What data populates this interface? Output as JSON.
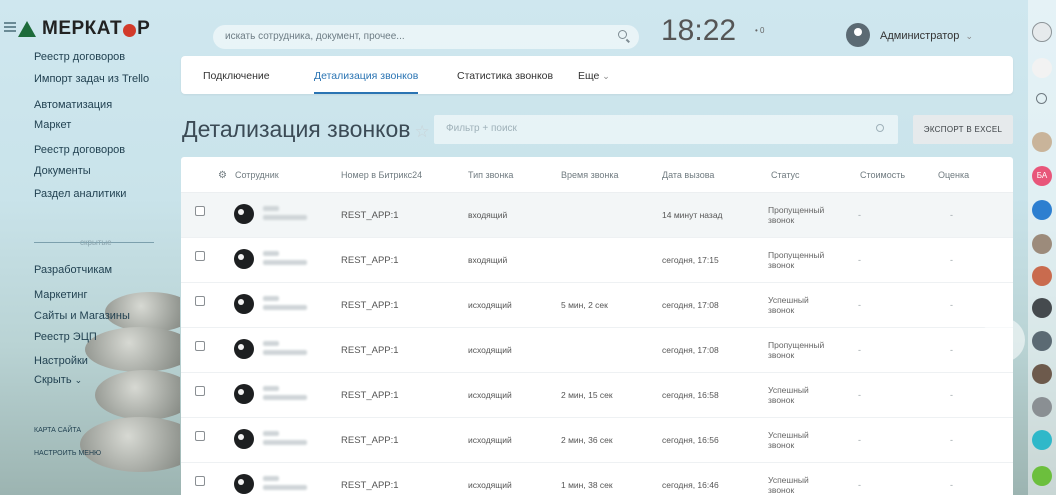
{
  "header": {
    "brand": "МЕРКАТ",
    "brand_suffix": "Р",
    "search_placeholder": "искать сотрудника, документ, прочее...",
    "time": "18:22",
    "notif": "• 0",
    "user_name": "Администратор",
    "user_chevron": "⌄"
  },
  "sidebar": {
    "items_top": [
      "Реестр договоров",
      "Импорт задач из Trello",
      "Автоматизация",
      "Маркет",
      "Реестр договоров",
      "Документы",
      "Раздел аналитики"
    ],
    "separator_label": "скрытые",
    "items_bottom": [
      "Разработчикам",
      "Маркетинг",
      "Сайты и Магазины",
      "Реестр ЭЦП",
      "Настройки",
      "Скрыть"
    ],
    "hide_suffix": "⌄",
    "links": [
      "КАРТА САЙТА",
      "НАСТРОИТЬ МЕНЮ"
    ]
  },
  "tabs": {
    "items": [
      "Подключение",
      "Детализация звонков",
      "Статистика звонков",
      "Еще"
    ],
    "more_chevron": "⌄"
  },
  "page": {
    "title": "Детализация звонков",
    "star": "☆",
    "filter_placeholder": "Фильтр + поиск",
    "export_label": "ЭКСПОРТ В EXCEL"
  },
  "table": {
    "columns": [
      "Сотрудник",
      "Номер в Битрикс24",
      "Тип звонка",
      "Время звонка",
      "Дата вызова",
      "Статус",
      "Стоимость",
      "Оценка"
    ],
    "settings_glyph": "⚙",
    "rows": [
      {
        "number": "REST_APP:1",
        "type": "входящий",
        "duration": "",
        "date": "14 минут назад",
        "status": [
          "Пропущенный",
          "звонок"
        ],
        "cost": "-",
        "rating": "-"
      },
      {
        "number": "REST_APP:1",
        "type": "входящий",
        "duration": "",
        "date": "сегодня, 17:15",
        "status": [
          "Пропущенный",
          "звонок"
        ],
        "cost": "-",
        "rating": "-"
      },
      {
        "number": "REST_APP:1",
        "type": "исходящий",
        "duration": "5 мин, 2 сек",
        "date": "сегодня, 17:08",
        "status": [
          "Успешный",
          "звонок"
        ],
        "cost": "-",
        "rating": "-"
      },
      {
        "number": "REST_APP:1",
        "type": "исходящий",
        "duration": "",
        "date": "сегодня, 17:08",
        "status": [
          "Пропущенный",
          "звонок"
        ],
        "cost": "-",
        "rating": "-"
      },
      {
        "number": "REST_APP:1",
        "type": "исходящий",
        "duration": "2 мин, 15 сек",
        "date": "сегодня, 16:58",
        "status": [
          "Успешный",
          "звонок"
        ],
        "cost": "-",
        "rating": "-"
      },
      {
        "number": "REST_APP:1",
        "type": "исходящий",
        "duration": "2 мин, 36 сек",
        "date": "сегодня, 16:56",
        "status": [
          "Успешный",
          "звонок"
        ],
        "cost": "-",
        "rating": "-"
      },
      {
        "number": "REST_APP:1",
        "type": "исходящий",
        "duration": "1 мин, 38 сек",
        "date": "сегодня, 16:46",
        "status": [
          "Успешный",
          "звонок"
        ],
        "cost": "-",
        "rating": "-"
      }
    ]
  },
  "right_bar": {
    "icons": [
      "help-icon",
      "bell-icon",
      "search-icon",
      "avatar",
      "avatar",
      "avatar",
      "avatar",
      "avatar",
      "avatar",
      "avatar",
      "avatar",
      "avatar",
      "chat-icon",
      "phone-icon"
    ],
    "badge_text": "БА"
  },
  "colors": {
    "accent": "#2a74b3",
    "brand_green": "#1d6b3a",
    "brand_red": "#d23a2a"
  }
}
